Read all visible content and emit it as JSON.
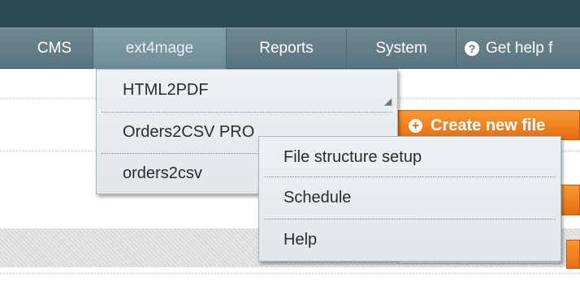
{
  "nav": {
    "items": [
      {
        "label": "CMS"
      },
      {
        "label": "ext4mage"
      },
      {
        "label": "Reports"
      },
      {
        "label": "System"
      }
    ],
    "help_label": "Get help f",
    "help_icon": "question-circle-icon"
  },
  "dropdown": {
    "items": [
      "HTML2PDF",
      "Orders2CSV PRO",
      "orders2csv"
    ]
  },
  "submenu": {
    "items": [
      "File structure setup",
      "Schedule",
      "Help"
    ]
  },
  "create_button": {
    "label": "Create new file",
    "icon": "plus-circle-icon"
  },
  "colors": {
    "nav_bg": "#587481",
    "top_band": "#2e4a55",
    "accent_orange": "#e66d11",
    "menu_bg": "#e6ebee"
  }
}
